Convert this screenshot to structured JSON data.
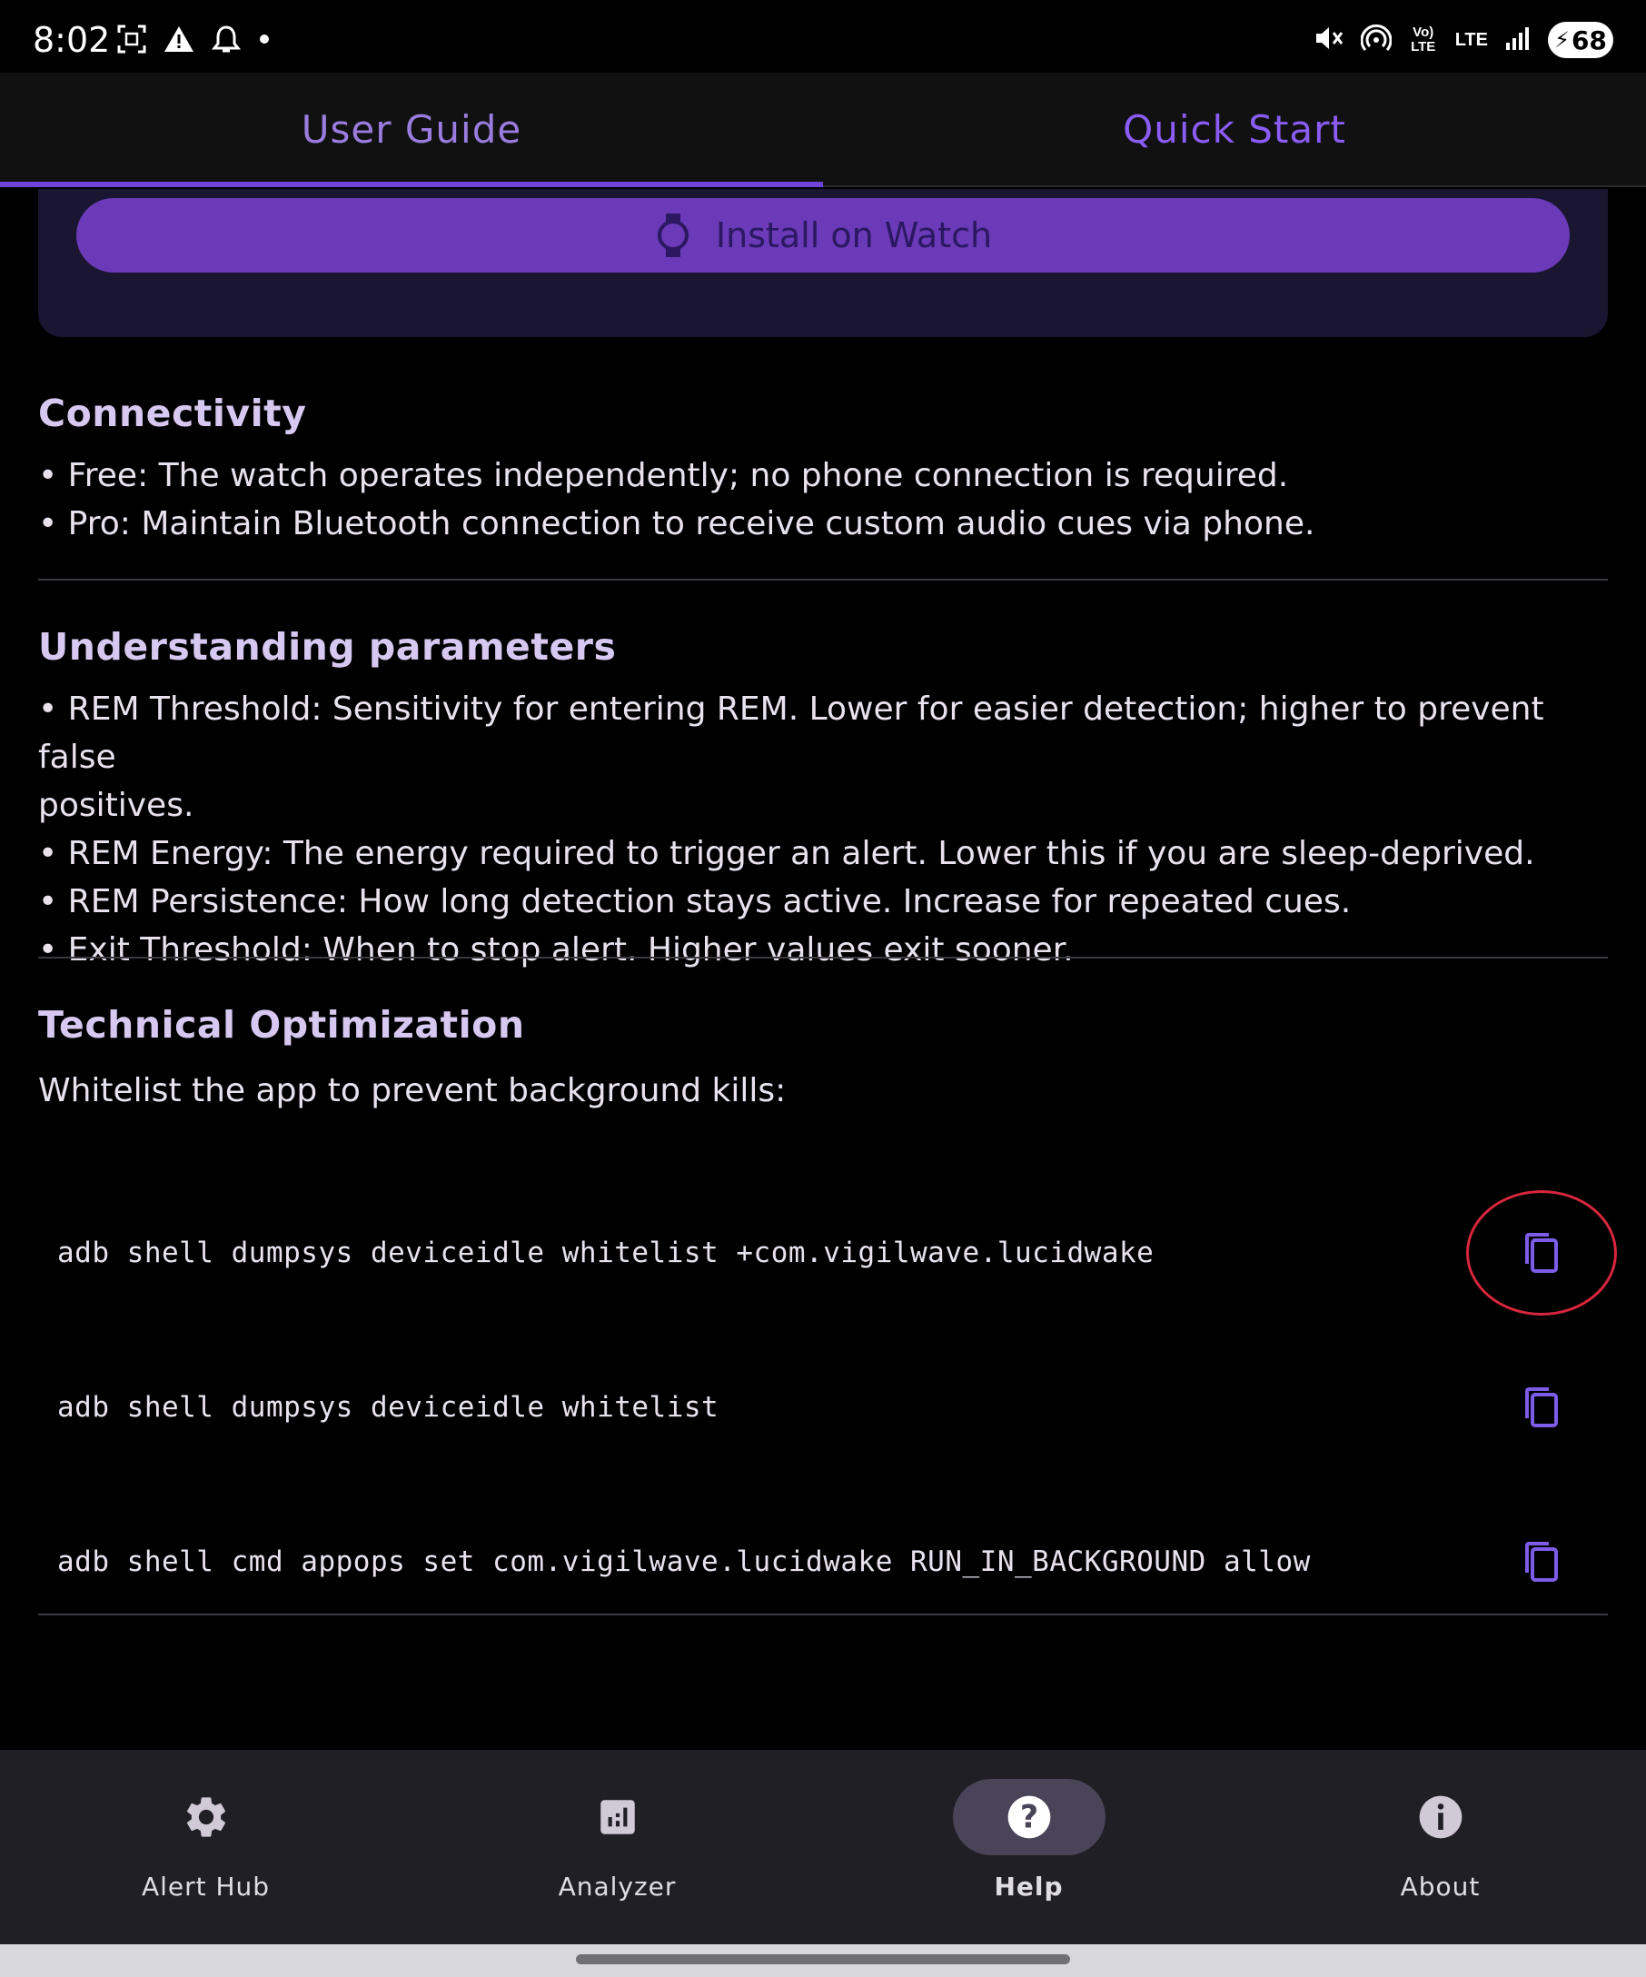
{
  "status_bar": {
    "time": "8:02",
    "battery": "68",
    "left_icons": [
      "screenshot-icon",
      "warning-icon",
      "alarm-icon",
      "dot-icon"
    ],
    "right_icons": [
      "mute-icon",
      "hotspot-icon",
      "volte-icon",
      "lte-icon",
      "signal-icon"
    ],
    "volte_label": "Vo) LTE",
    "lte_label": "LTE"
  },
  "tabs": [
    {
      "label": "User Guide",
      "active": true
    },
    {
      "label": "Quick Start",
      "active": false
    }
  ],
  "install": {
    "label": "Install on Watch",
    "icon": "watch-icon"
  },
  "connectivity": {
    "title": "Connectivity",
    "bullets": [
      "• Free: The watch operates independently; no phone connection is required.",
      "• Pro: Maintain Bluetooth connection to receive custom audio cues via phone."
    ]
  },
  "parameters": {
    "title": "Understanding parameters",
    "bullets": [
      "• REM Threshold: Sensitivity for entering REM. Lower for easier detection; higher to prevent false",
      "positives.",
      "• REM Energy: The energy required to trigger an alert. Lower this if you are sleep-deprived.",
      "• REM Persistence: How long detection stays active. Increase for repeated cues.",
      "• Exit Threshold: When to stop alert. Higher values exit sooner."
    ]
  },
  "technical": {
    "title": "Technical Optimization",
    "intro": "Whitelist the app to prevent background kills:",
    "commands": [
      "adb shell dumpsys deviceidle whitelist +com.vigilwave.lucidwake",
      "adb shell dumpsys deviceidle whitelist",
      "adb shell cmd appops set com.vigilwave.lucidwake RUN_IN_BACKGROUND allow"
    ]
  },
  "bottom_nav": [
    {
      "label": "Alert Hub",
      "icon": "gear-icon",
      "active": false
    },
    {
      "label": "Analyzer",
      "icon": "chart-icon",
      "active": false
    },
    {
      "label": "Help",
      "icon": "help-icon",
      "active": true
    },
    {
      "label": "About",
      "icon": "info-icon",
      "active": false
    }
  ],
  "colors": {
    "accent": "#8b5cf6",
    "button": "#6a3ab8",
    "highlight": "#d7263d"
  }
}
